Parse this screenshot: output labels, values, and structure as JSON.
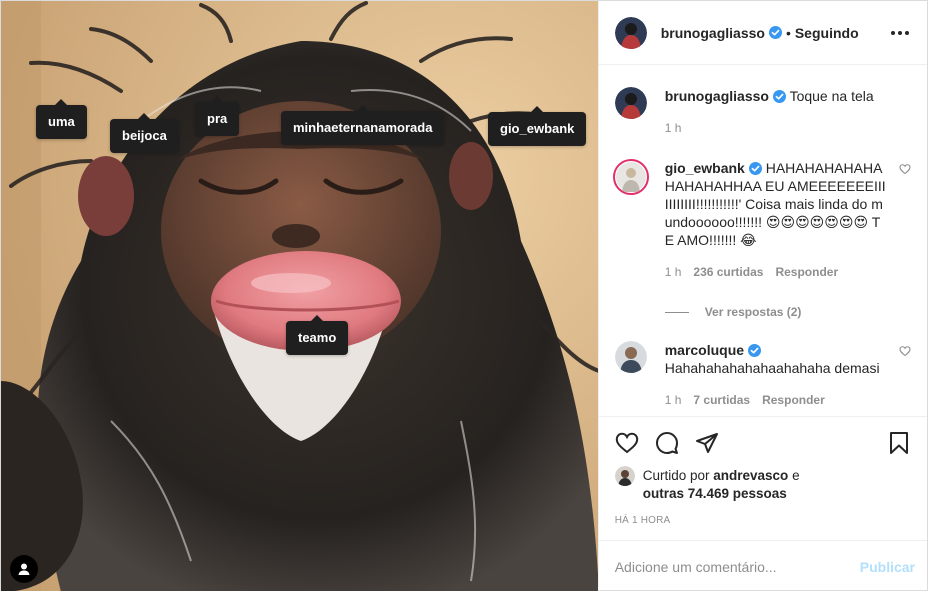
{
  "media": {
    "tags": [
      "uma",
      "beijoca",
      "pra",
      "minhaeternanamorada",
      "gio_ewbank",
      "teamo"
    ]
  },
  "header": {
    "username": "brunogagliasso",
    "separator": "•",
    "follow_status": "Seguindo"
  },
  "caption": {
    "username": "brunogagliasso",
    "text": "Toque na tela",
    "time": "1 h"
  },
  "comments": [
    {
      "username": "gio_ewbank",
      "text": "HAHAHAHAHAHAHAHAHAHHAA EU AMEEEEEEEIIIIIIIIIII!!!!!!!!!!!' Coisa mais linda do mundoooooo!!!!!!! 😍😍😍😍😍😍😍 TE AMO!!!!!!! 😂",
      "time": "1 h",
      "likes": "236 curtidas",
      "reply": "Responder",
      "view_replies": "Ver respostas (2)"
    },
    {
      "username": "marcoluque",
      "text": "Hahahahahahahaahahaha demasi",
      "time": "1 h",
      "likes": "7 curtidas",
      "reply": "Responder"
    }
  ],
  "likes": {
    "prefix": "Curtido por",
    "user": "andrevasco",
    "mid": "e",
    "others": "outras 74.469 pessoas"
  },
  "timestamp": "HÁ 1 HORA",
  "add_comment": {
    "placeholder": "Adicione um comentário...",
    "publish": "Publicar"
  },
  "colors": {
    "verified": "#3897f0",
    "publish_disabled": "#b2dffc",
    "secondary_text": "#8e8e8e"
  },
  "icons": [
    "heart-icon",
    "comment-icon",
    "share-icon",
    "bookmark-icon",
    "more-icon",
    "verified-icon",
    "person-icon"
  ]
}
